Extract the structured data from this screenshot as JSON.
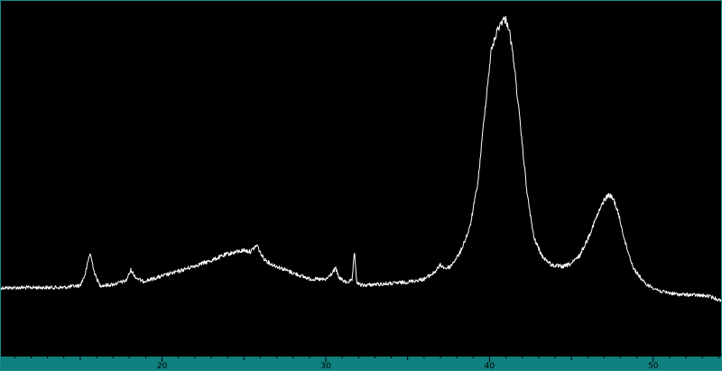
{
  "colors": {
    "background": "#000000",
    "frame": "#1a8a8a",
    "axis_bar": "#0f7f7f",
    "trace": "#ffffff",
    "tick_text": "#000000"
  },
  "chart_data": {
    "type": "line",
    "title": "",
    "xlabel": "",
    "ylabel": "",
    "xlim": [
      10.1,
      54.2
    ],
    "ylim": [
      0,
      100
    ],
    "grid": false,
    "legend": "none",
    "x_ticks": [
      20,
      30,
      40,
      50
    ],
    "x_tick_labels": [
      "20",
      "30",
      "40",
      "50"
    ],
    "series": [
      {
        "x": [
          10.1,
          12,
          14,
          15.0,
          15.3,
          15.6,
          15.9,
          16.2,
          16.6,
          17,
          17.8,
          18.1,
          18.4,
          18.8,
          19.3,
          20,
          21,
          22,
          23,
          24,
          25,
          25.4,
          25.8,
          26.0,
          26.2,
          26.6,
          27.2,
          28,
          29,
          30,
          30.4,
          30.6,
          30.8,
          31.2,
          31.6,
          31.75,
          31.9,
          32.2,
          33,
          34,
          35,
          36,
          36.6,
          37.0,
          37.3,
          37.6,
          38.2,
          38.8,
          39.3,
          39.7,
          40.1,
          40.5,
          40.8,
          41.0,
          41.2,
          41.5,
          41.9,
          42.3,
          42.7,
          43.2,
          43.8,
          44.5,
          45.0,
          45.5,
          46.0,
          46.5,
          47.0,
          47.3,
          47.6,
          47.9,
          48.3,
          48.8,
          49.5,
          50.5,
          51.5,
          52.5,
          53.4,
          54.2
        ],
        "y": [
          13.7,
          13.8,
          13.8,
          14.5,
          18,
          25,
          18,
          14.5,
          14.5,
          14.8,
          16,
          19.5,
          17,
          15.8,
          16.4,
          17.5,
          19,
          20.8,
          22.5,
          24.6,
          25.8,
          25.4,
          27.5,
          25,
          23.2,
          21.5,
          20.2,
          18.5,
          16.6,
          16.3,
          18.5,
          20,
          17,
          15.5,
          16,
          25,
          15.2,
          14.5,
          14.8,
          15.1,
          15.6,
          16.5,
          18.5,
          21,
          20,
          20.5,
          25,
          33,
          48,
          70,
          90,
          97,
          100,
          100,
          97,
          86,
          65,
          44,
          30,
          24,
          21,
          20.5,
          21.5,
          24,
          29.5,
          36,
          42,
          43.7,
          42,
          37,
          28,
          20,
          15,
          12.5,
          11.6,
          11.4,
          11.0,
          9.5
        ]
      }
    ]
  }
}
